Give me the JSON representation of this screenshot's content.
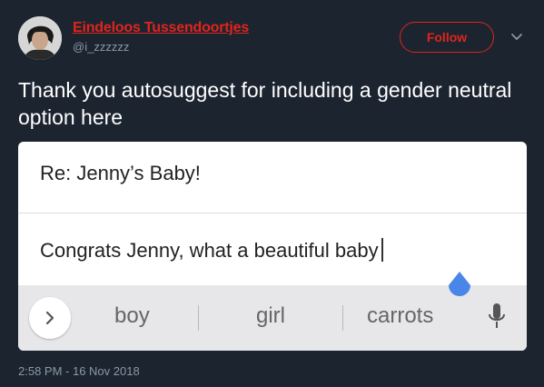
{
  "author": {
    "display_name": "Eindeloos Tussendoortjes",
    "handle": "@i_zzzzzz",
    "avatar_icon": "profile-photo"
  },
  "actions": {
    "follow_label": "Follow",
    "more_icon": "chevron-down-icon"
  },
  "tweet": {
    "text": "Thank you autosuggest for including a gender neutral option here",
    "timestamp": "2:58 PM - 16 Nov 2018"
  },
  "screenshot": {
    "subject": "Re: Jenny’s Baby!",
    "body": "Congrats Jenny, what a beautiful baby",
    "suggestions": [
      "boy",
      "girl",
      "carrots"
    ],
    "expand_icon": "chevron-right-icon",
    "mic_icon": "microphone-icon"
  },
  "colors": {
    "background": "#1c2430",
    "accent": "#e0241b",
    "muted": "#8899a6",
    "cursor_handle": "#4a86e8"
  }
}
